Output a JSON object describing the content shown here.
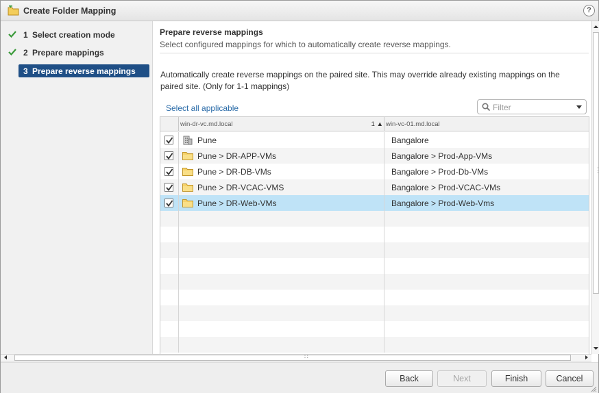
{
  "dialog": {
    "title": "Create Folder Mapping",
    "help": "?"
  },
  "steps": [
    {
      "num": "1",
      "label": "Select creation mode",
      "state": "done"
    },
    {
      "num": "2",
      "label": "Prepare mappings",
      "state": "done"
    },
    {
      "num": "3",
      "label": "Prepare reverse mappings",
      "state": "active"
    }
  ],
  "main": {
    "title": "Prepare reverse mappings",
    "subtitle": "Select configured mappings for which to automatically create reverse mappings.",
    "description": "Automatically create reverse mappings on the paired site. This may override already existing mappings on the paired site. (Only for 1-1 mappings)",
    "select_all": "Select all applicable",
    "filter_placeholder": "Filter"
  },
  "grid": {
    "col1_header": "win-dr-vc.md.local",
    "col1_sort": "1 ▲",
    "col2_header": "win-vc-01.md.local",
    "rows": [
      {
        "checked": true,
        "icon": "datacenter-icon",
        "source": "Pune",
        "target": "Bangalore"
      },
      {
        "checked": true,
        "icon": "folder-icon",
        "source": "Pune > DR-APP-VMs",
        "target": "Bangalore > Prod-App-VMs"
      },
      {
        "checked": true,
        "icon": "folder-icon",
        "source": "Pune > DR-DB-VMs",
        "target": "Bangalore > Prod-Db-VMs"
      },
      {
        "checked": true,
        "icon": "folder-icon",
        "source": "Pune > DR-VCAC-VMS",
        "target": "Bangalore > Prod-VCAC-VMs"
      },
      {
        "checked": true,
        "icon": "folder-icon",
        "source": "Pune > DR-Web-VMs",
        "target": "Bangalore > Prod-Web-Vms",
        "selected": true
      }
    ],
    "empty_rows": 9
  },
  "footer": {
    "back": "Back",
    "next": "Next",
    "finish": "Finish",
    "cancel": "Cancel"
  },
  "colors": {
    "active_step": "#1f4f86",
    "selected_row": "#bfe3f7",
    "link": "#2a6ba8",
    "check": "#3a9a3a"
  }
}
